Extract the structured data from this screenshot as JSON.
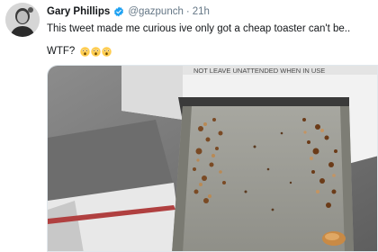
{
  "tweet": {
    "author_name": "Gary Phillips",
    "handle": "@gazpunch",
    "separator": "·",
    "timestamp": "21h",
    "text_line1": "This tweet made me curious ive only got a cheap toaster can't be..",
    "text_line2": "WTF?",
    "emojis": [
      "astonished-face-icon",
      "astonished-face-icon",
      "astonished-face-icon"
    ],
    "verified_icon": "verified-badge-icon",
    "avatar": "avatar-photo"
  },
  "photo": {
    "description_icon": "toaster-crumb-tray-photo",
    "printed_label": "NOT LEAVE UNATTENDED WHEN IN USE"
  },
  "colors": {
    "text": "#14171a",
    "secondary": "#657786",
    "verified": "#1da1f2"
  }
}
